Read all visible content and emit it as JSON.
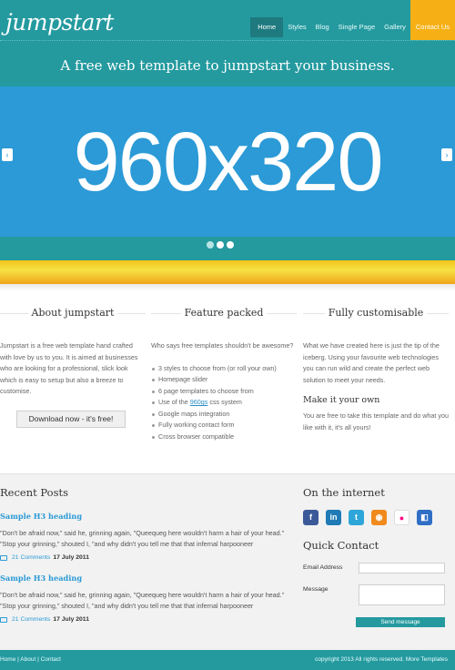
{
  "header": {
    "logo": "jumpstart",
    "nav": [
      "Home",
      "Styles",
      "Blog",
      "Single Page",
      "Gallery",
      "Contact Us"
    ],
    "tagline": "A free web template to jumpstart your business."
  },
  "slider": {
    "text": "960x320",
    "prev_arrow": "‹",
    "next_arrow": "›",
    "dots": 3,
    "active_dot": 1
  },
  "columns": {
    "about": {
      "title": "About jumpstart",
      "text": "Jumpstart is a free web template hand crafted with love by us to you. It is aimed at businesses who are looking for a professional, slick look which is easy to setup but also a breeze to customise.",
      "button": "Download now - it's free!"
    },
    "features": {
      "title": "Feature packed",
      "intro": "Who says free templates shouldn't be awesome?",
      "items": [
        "3 styles to choose from (or roll your own)",
        "Homepage slider",
        "6 page templates to choose from",
        "Google maps integration",
        "Fully working contact form",
        "Cross browser compatible"
      ],
      "grid_item_prefix": "Use of the ",
      "grid_item_link": "960gs",
      "grid_item_suffix": " css system"
    },
    "custom": {
      "title": "Fully customisable",
      "text": "What we have created here is just the tip of the iceberg. Using your favourite web technologies you can run wild and create the perfect web solution to meet your needs.",
      "subtitle": "Make it your own",
      "text2": "You are free to take this template and do what you like with it, it's all yours!"
    }
  },
  "recent_posts": {
    "title": "Recent Posts",
    "posts": [
      {
        "title": "Sample H3 heading",
        "body": "\"Don't be afraid now,\" said he, grinning again, \"Queequeg here wouldn't harm a hair of your head.\" \"Stop your grinning,\" shouted I, \"and why didn't you tell me that that infernal harpooneer",
        "comments": "21 Comments",
        "date": "17 July 2011"
      },
      {
        "title": "Sample H3 heading",
        "body": "\"Don't be afraid now,\" said he, grinning again, \"Queequeg here wouldn't harm a hair of your head.\" \"Stop your grinning,\" shouted I, \"and why didn't you tell me that that infernal harpooneer",
        "comments": "21 Comments",
        "date": "17 July 2011"
      }
    ]
  },
  "sidebar": {
    "internet_title": "On the internet",
    "socials": [
      {
        "icon": "facebook-icon",
        "glyph": "f",
        "color": "#3b5998"
      },
      {
        "icon": "linkedin-icon",
        "glyph": "in",
        "color": "#1f7ab5"
      },
      {
        "icon": "twitter-icon",
        "glyph": "t",
        "color": "#2fa6d9"
      },
      {
        "icon": "rss-icon",
        "glyph": "◉",
        "color": "#f08a1d"
      },
      {
        "icon": "flickr-icon",
        "glyph": "●",
        "color": "#ffffff"
      },
      {
        "icon": "delicious-icon",
        "glyph": "◧",
        "color": "#2f6fc6"
      }
    ],
    "quick_contact_title": "Quick Contact",
    "email_label": "Email Address",
    "message_label": "Message",
    "send_button": "Send message"
  },
  "footer": {
    "links": "Home | About | Contact",
    "copyright": "copyright 2013 All rights reserved. More Templates"
  },
  "colors": {
    "teal": "#249a9f",
    "slider_blue": "#2b9ad6",
    "accent_yellow": "#f6b015"
  }
}
